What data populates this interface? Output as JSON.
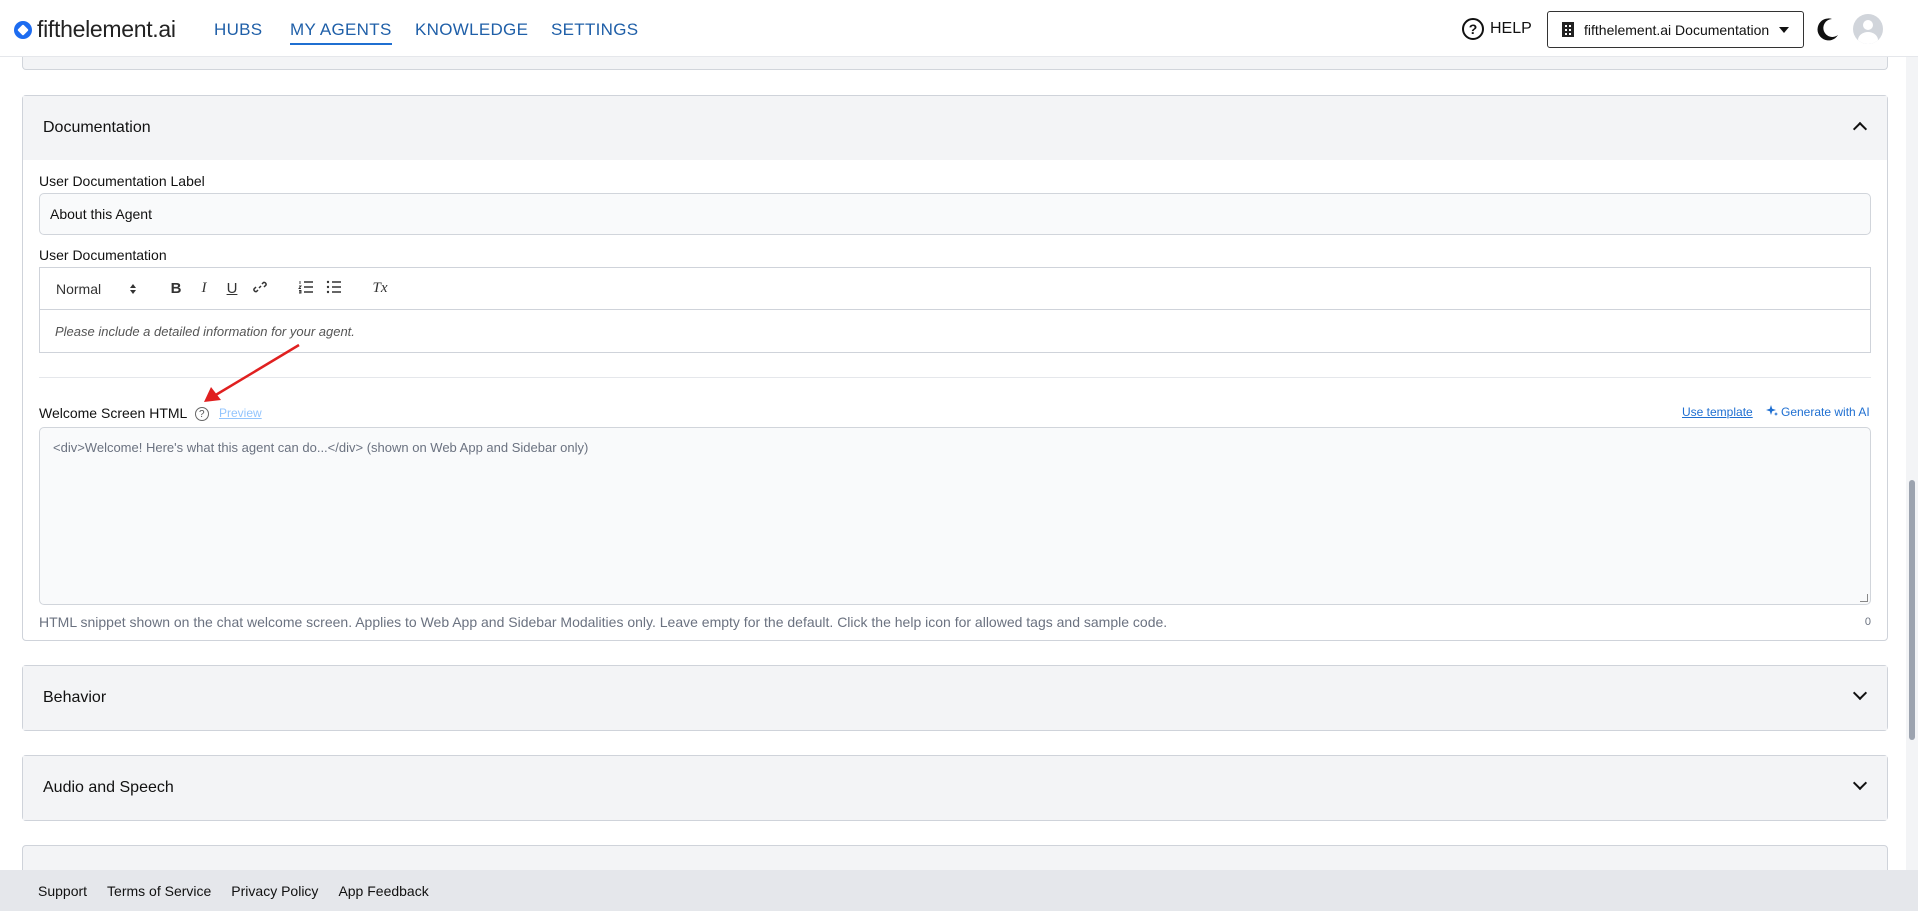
{
  "brand": {
    "name": "fifthelement.ai"
  },
  "nav": {
    "links": [
      "HUBS",
      "MY AGENTS",
      "KNOWLEDGE",
      "SETTINGS"
    ],
    "active": "MY AGENTS",
    "help_label": "HELP",
    "org_label": "fifthelement.ai Documentation"
  },
  "documentation": {
    "title": "Documentation",
    "user_doc_label_label": "User Documentation Label",
    "user_doc_label_value": "About this Agent",
    "user_doc_label": "User Documentation",
    "toolbar": {
      "format": "Normal",
      "bold": "B",
      "italic": "I",
      "underline": "U",
      "clear": "Tx"
    },
    "editor_placeholder": "Please include a detailed information for your agent.",
    "welcome_label": "Welcome Screen HTML",
    "help_mark": "?",
    "preview_label": "Preview",
    "use_template_label": "Use template",
    "generate_label": "Generate with AI",
    "welcome_placeholder": "<div>Welcome! Here's what this agent can do...</div>  (shown on Web App and Sidebar only)",
    "welcome_hint": "HTML snippet shown on the chat welcome screen. Applies to Web App and Sidebar Modalities only. Leave empty for the default. Click the help icon for allowed tags and sample code.",
    "char_count": "0"
  },
  "sections": {
    "behavior": "Behavior",
    "audio": "Audio and Speech"
  },
  "footer": [
    "Support",
    "Terms of Service",
    "Privacy Policy",
    "App Feedback"
  ],
  "colors": {
    "accent": "#1f6fd1",
    "nav_link": "#1f5fa8",
    "annotation_arrow": "#e02020"
  }
}
